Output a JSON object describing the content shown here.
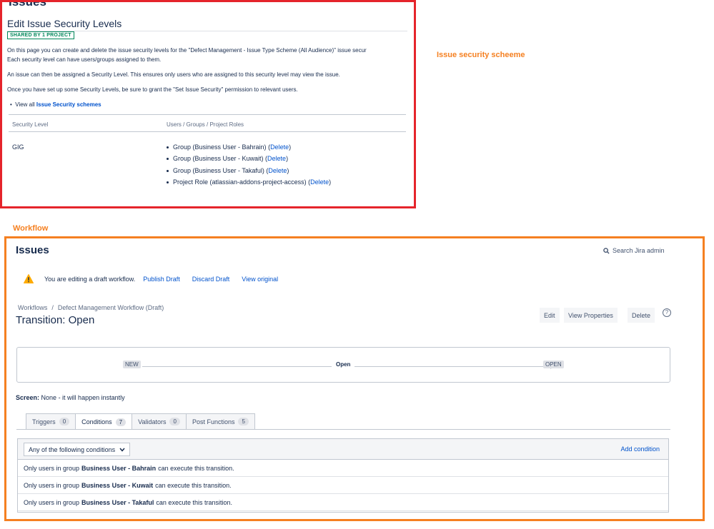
{
  "security_panel": {
    "cut_title": "Issues",
    "title": "Edit Issue Security Levels",
    "badge": "SHARED BY 1 PROJECT",
    "para1_line1": "On this page you can create and delete the issue security levels for the \"Defect Management - Issue Type Scheme (All Audience)\" issue secur",
    "para1_line2": "Each security level can have users/groups assigned to them.",
    "para2": "An issue can then be assigned a Security Level. This ensures only users who are assigned to this security level may view the issue.",
    "para3": "Once you have set up some Security Levels, be sure to grant the \"Set Issue Security\" permission to relevant users.",
    "view_all_prefix": "View all",
    "view_all_link": "Issue Security schemes",
    "col_level": "Security Level",
    "col_members": "Users / Groups / Project Roles",
    "level_name": "GIG",
    "members": [
      {
        "text": "Group (Business User - Bahrain)",
        "action": "Delete"
      },
      {
        "text": "Group (Business User - Kuwait)",
        "action": "Delete"
      },
      {
        "text": "Group (Business User - Takaful)",
        "action": "Delete"
      },
      {
        "text": "Project Role (atlassian-addons-project-access)",
        "action": "Delete"
      }
    ]
  },
  "annotations": {
    "scheme_note": "Issue security scheeme",
    "workflow_note": "Workflow"
  },
  "workflow_panel": {
    "heading": "Issues",
    "search_label": "Search Jira admin",
    "draft_message": "You are editing a draft workflow.",
    "publish_draft": "Publish Draft",
    "discard_draft": "Discard Draft",
    "view_original": "View original",
    "breadcrumb_root": "Workflows",
    "breadcrumb_sep": "/",
    "breadcrumb_current": "Defect Management Workflow (Draft)",
    "transition_title": "Transition: Open",
    "btn_edit": "Edit",
    "btn_view_properties": "View Properties",
    "btn_delete": "Delete",
    "help_glyph": "?",
    "diagram": {
      "from_status": "NEW",
      "transition_name": "Open",
      "to_status": "OPEN"
    },
    "screen_label": "Screen:",
    "screen_value": "None - it will happen instantly",
    "tabs": [
      {
        "label": "Triggers",
        "count": "0"
      },
      {
        "label": "Conditions",
        "count": "7"
      },
      {
        "label": "Validators",
        "count": "0"
      },
      {
        "label": "Post Functions",
        "count": "5"
      }
    ],
    "condition_mode": "Any of the following conditions",
    "add_condition": "Add condition",
    "conditions": [
      {
        "prefix": "Only users in group",
        "group": "Business User - Bahrain",
        "suffix": "can execute this transition."
      },
      {
        "prefix": "Only users in group",
        "group": "Business User - Kuwait",
        "suffix": "can execute this transition."
      },
      {
        "prefix": "Only users in group",
        "group": "Business User - Takaful",
        "suffix": "can execute this transition."
      }
    ]
  },
  "colors": {
    "security_border": "#e5242b",
    "workflow_border": "#f58021",
    "link": "#0052cc",
    "badge_green": "#00875a"
  }
}
